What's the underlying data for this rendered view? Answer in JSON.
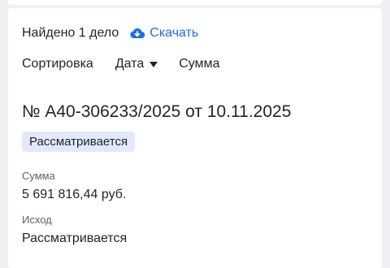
{
  "header": {
    "found_text": "Найдено 1 дело",
    "download_label": "Скачать",
    "download_icon": "cloud-download-icon",
    "accent_color": "#1e6ee8"
  },
  "sort": {
    "label": "Сортировка",
    "options": [
      "Дата",
      "Сумма"
    ],
    "date_label": "Дата",
    "sum_label": "Сумма"
  },
  "case": {
    "title": "№ А40-306233/2025 от 10.11.2025",
    "status_badge": "Рассматривается",
    "badge_color": "#e3e9fb",
    "amount_label": "Сумма",
    "amount_value": "5 691 816,44 руб.",
    "outcome_label": "Исход",
    "outcome_value": "Рассматривается"
  }
}
